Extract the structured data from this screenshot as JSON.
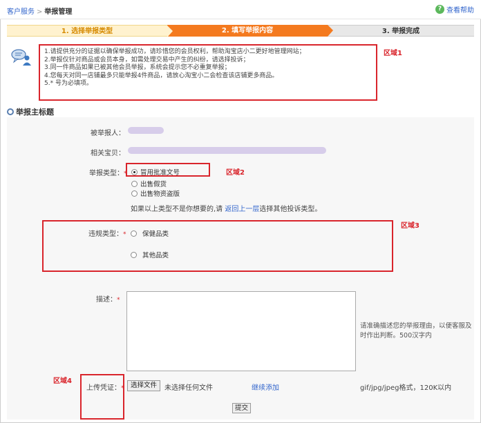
{
  "breadcrumb": {
    "root": "客户服务",
    "separator": ">",
    "current": "举报管理"
  },
  "help": {
    "label": "查看帮助",
    "icon": "help-icon"
  },
  "steps": [
    "1. 选择举报类型",
    "2. 填写举报内容",
    "3. 举报完成"
  ],
  "notice": {
    "icon": "chat-user-icon",
    "lines": [
      "1.请提供充分的证据以确保举报成功，请珍惜您的会员权利，帮助淘宝店小二更好地管理网站；",
      "2.举报仅针对商品或会员本身，如需处理交易中产生的纠纷，请选择投诉；",
      "3.同一件商品如果已被其他会员举报，系统会提示您不必重复举报；",
      "4.您每天对同一店铺最多只能举报4件商品，请放心淘宝小二会检查该店铺更多商品。",
      "5.* 号为必填项。"
    ]
  },
  "areas": {
    "a1": "区域1",
    "a2": "区域2",
    "a3": "区域3",
    "a4": "区域4"
  },
  "section_title": "举报主标题",
  "form": {
    "reported_user_label": "被举报人：",
    "related_item_label": "相关宝贝：",
    "report_type_label": "举报类型：",
    "report_types": [
      "冒用批准文号",
      "出售假货",
      "出售物资盗版"
    ],
    "report_type_selected": "冒用批准文号",
    "other_type_prefix": "如果以上类型不是你想要的,请",
    "other_type_link": "返回上一层",
    "other_type_suffix": "选择其他投诉类型。",
    "violation_label": "违规类型：",
    "violations": [
      "保健品类",
      "其他品类"
    ],
    "description_label": "描述：",
    "description_hint": "请准确描述您的举报理由，以便客服及时作出判断。500汉字内",
    "upload_label": "上传凭证：",
    "choose_file": "选择文件",
    "no_file": "未选择任何文件",
    "add_more": "继续添加",
    "file_format": "gif/jpg/jpeg格式，120K以内",
    "submit": "提交",
    "required_mark": "*"
  }
}
